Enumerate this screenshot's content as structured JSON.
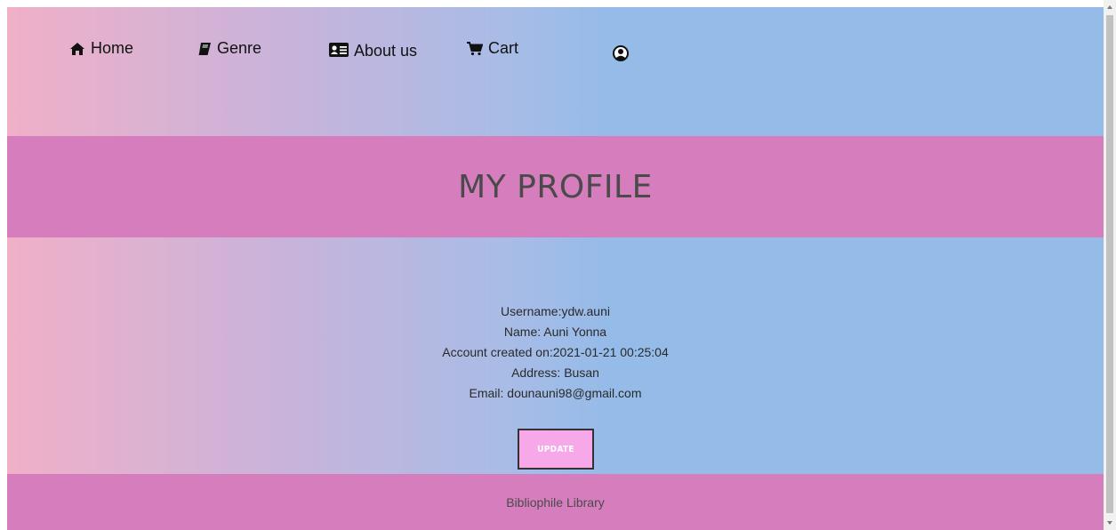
{
  "nav": {
    "items": [
      {
        "label": "Home",
        "icon": "home-icon"
      },
      {
        "label": "Genre",
        "icon": "book-icon"
      },
      {
        "label": "About us",
        "icon": "id-card-icon"
      },
      {
        "label": "Cart",
        "icon": "cart-icon"
      },
      {
        "label": "",
        "icon": "user-circle-icon"
      }
    ]
  },
  "banner": {
    "title": "MY PROFILE"
  },
  "profile": {
    "username": "Username:ydw.auni",
    "name": "Name: Auni Yonna",
    "created": "Account created on:2021-01-21 00:25:04",
    "address": "Address: Busan",
    "email": "Email: dounauni98@gmail.com"
  },
  "actions": {
    "update_label": "UPDATE"
  },
  "footer": {
    "text": "Bibliophile Library"
  },
  "colors": {
    "banner": "#d67dbd",
    "gradient_left": "#f0b0c8",
    "gradient_right": "#95bbe9",
    "button": "#f6a8e8"
  }
}
